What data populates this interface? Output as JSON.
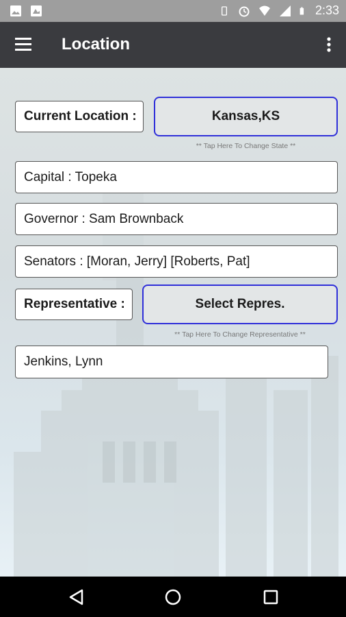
{
  "status_bar": {
    "time": "2:33",
    "icons": [
      "image-icon",
      "photo-icon",
      "phone-icon",
      "alarm-icon",
      "wifi-icon",
      "signal-icon",
      "battery-icon"
    ]
  },
  "app_bar": {
    "title": "Location",
    "menu_icon": "hamburger-menu-icon",
    "overflow_icon": "more-vertical-icon"
  },
  "location": {
    "current_label": "Current Location :",
    "state_button": "Kansas,KS",
    "state_hint": "** Tap Here To Change State **",
    "capital": "Capital : Topeka",
    "governor": "Governor : Sam Brownback",
    "senators": "Senators : [Moran, Jerry] [Roberts, Pat]",
    "representative_label": "Representative :",
    "representative_button": "Select Repres.",
    "representative_hint": "** Tap Here To Change Representative **",
    "representative_name": "Jenkins, Lynn"
  },
  "nav_bar": {
    "back": "back-icon",
    "home": "home-icon",
    "recents": "recents-icon"
  },
  "colors": {
    "app_bar": "#3a3b3f",
    "button_border": "#2f2fd9",
    "status_bar": "#9e9e9e"
  }
}
